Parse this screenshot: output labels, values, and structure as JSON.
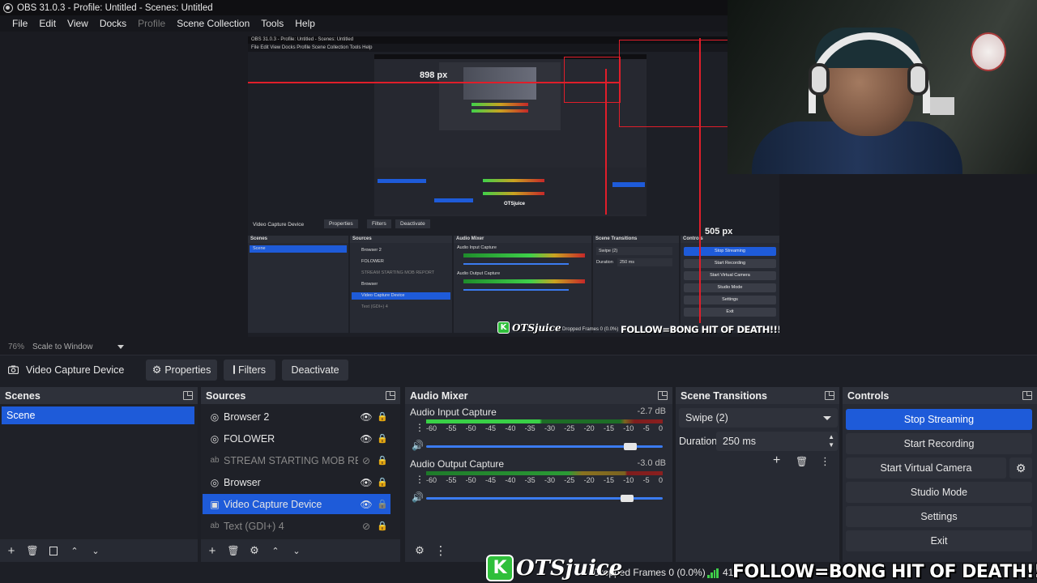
{
  "window": {
    "title": "OBS 31.0.3 - Profile: Untitled - Scenes: Untitled"
  },
  "menu": [
    "File",
    "Edit",
    "View",
    "Docks",
    "Profile",
    "Scene Collection",
    "Tools",
    "Help"
  ],
  "preview": {
    "label_898": "898 px",
    "label_505": "505 px",
    "nested_title": "OBS 31.0.3 - Profile: Untitled - Scenes: Untitled",
    "nested_menu": "File   Edit   View   Docks   Profile   Scene Collection   Tools   Help",
    "nested_source_name": "Video Capture Device",
    "nested_props": "Properties",
    "nested_filters": "Filters",
    "nested_deactivate": "Deactivate",
    "nested_scenes": "Scenes",
    "nested_sources": "Sources",
    "nested_mixer": "Audio Mixer",
    "nested_transitions": "Scene Transitions",
    "nested_controls": "Controls",
    "nested_scene_item": "Scene",
    "nested_source_items": [
      "Browser 2",
      "FOLOWER",
      "STREAM STARTING MOB REPORT",
      "Browser",
      "Video Capture Device",
      "Text (GDI+) 4"
    ],
    "nested_ch1": "Audio Input Capture",
    "nested_ch2": "Audio Output Capture",
    "nested_swipe": "Swipe (2)",
    "nested_duration": "Duration",
    "nested_duration_val": "250 ms",
    "nested_controls_buttons": [
      "Stop Streaming",
      "Start Recording",
      "Start Virtual Camera",
      "Studio Mode",
      "Settings",
      "Exit"
    ],
    "overlay_logo": "OTSjuice",
    "overlay_logo_k": "K",
    "overlay_dropped": "Dropped Frames 0 (0.0%)",
    "overlay_follow": "FOLLOW=BONG HIT OF DEATH!!!"
  },
  "scale": {
    "percent": "76%",
    "mode": "Scale to Window"
  },
  "source_toolbar": {
    "name": "Video Capture Device",
    "properties": "Properties",
    "filters": "Filters",
    "deactivate": "Deactivate"
  },
  "scenes": {
    "title": "Scenes",
    "items": [
      "Scene"
    ]
  },
  "sources": {
    "title": "Sources",
    "items": [
      {
        "name": "Browser 2",
        "icon": "globe-icon",
        "visible": true,
        "dim": false,
        "selected": false
      },
      {
        "name": "FOLOWER",
        "icon": "globe-icon",
        "visible": true,
        "dim": false,
        "selected": false
      },
      {
        "name": "STREAM STARTING MOB REPORT",
        "icon": "text-icon",
        "visible": false,
        "dim": true,
        "selected": false
      },
      {
        "name": "Browser",
        "icon": "globe-icon",
        "visible": true,
        "dim": false,
        "selected": false
      },
      {
        "name": "Video Capture Device",
        "icon": "camera-icon",
        "visible": true,
        "dim": false,
        "selected": true
      },
      {
        "name": "Text (GDI+) 4",
        "icon": "text-icon",
        "visible": false,
        "dim": true,
        "selected": false
      }
    ]
  },
  "mixer": {
    "title": "Audio Mixer",
    "channels": [
      {
        "name": "Audio Input Capture",
        "db": "-2.7 dB",
        "volume": 0.85
      },
      {
        "name": "Audio Output Capture",
        "db": "-3.0 dB",
        "volume": 0.83
      }
    ],
    "ticks": [
      "-60",
      "-55",
      "-50",
      "-45",
      "-40",
      "-35",
      "-30",
      "-25",
      "-20",
      "-15",
      "-10",
      "-5",
      "0"
    ]
  },
  "transitions": {
    "title": "Scene Transitions",
    "selected": "Swipe (2)",
    "duration_label": "Duration",
    "duration_value": "250 ms"
  },
  "controls": {
    "title": "Controls",
    "buttons": [
      "Stop Streaming",
      "Start Recording",
      "Start Virtual Camera",
      "Studio Mode",
      "Settings",
      "Exit"
    ]
  },
  "status": {
    "dropped": "Dropped Frames 0 (0.0%)",
    "num": "41"
  },
  "overlay": {
    "logo_k": "K",
    "logo_text": "OTSjuice",
    "follow": "FOLLOW=BONG HIT OF DEATH!!!"
  },
  "colors": {
    "accent": "#1e5bd9",
    "red_guide": "#e01e2a",
    "logo_green": "#2fbf3b"
  }
}
